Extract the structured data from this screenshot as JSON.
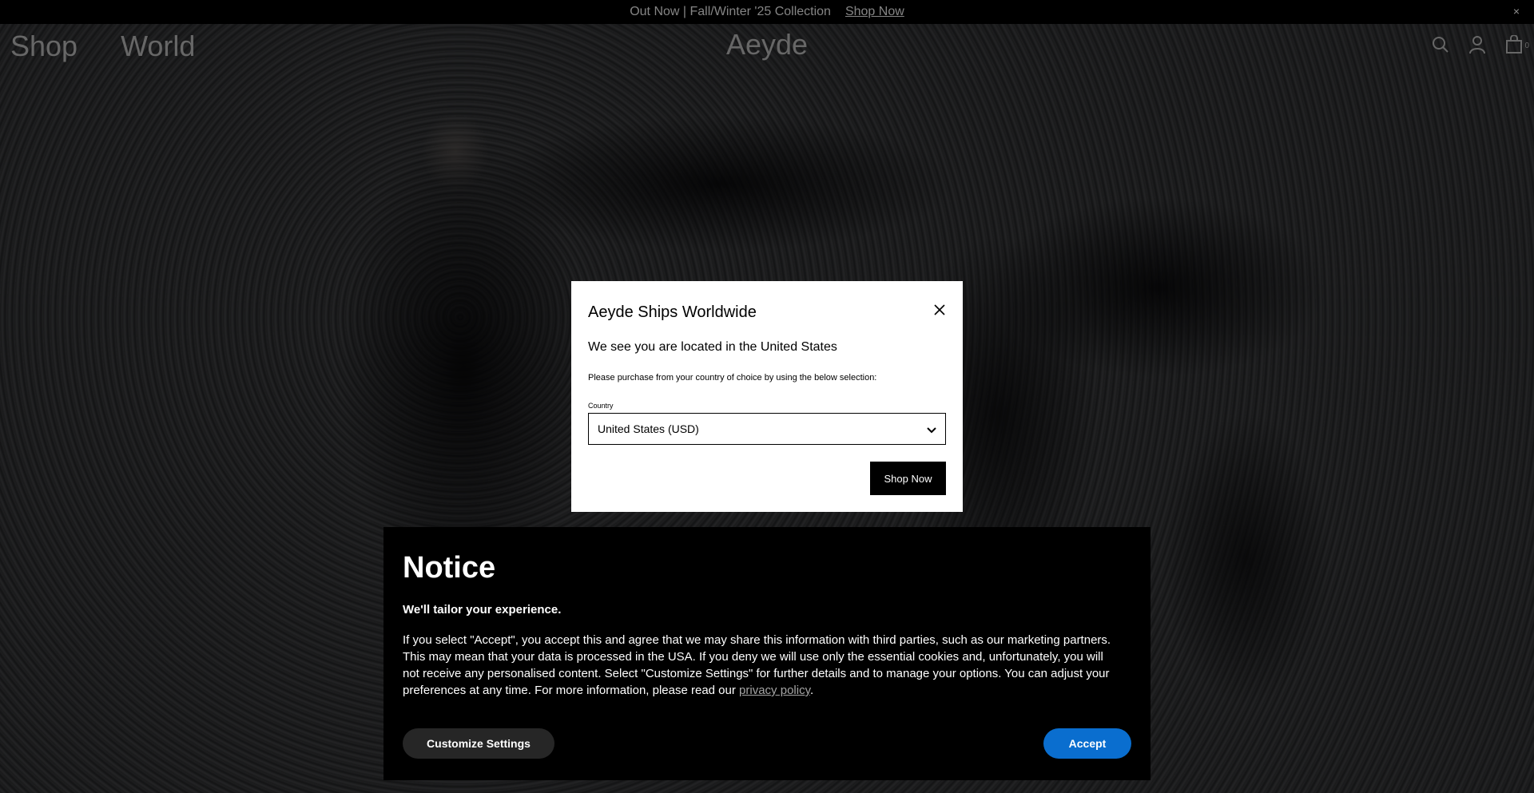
{
  "announcement": {
    "text": "Out Now | Fall/Winter '25 Collection",
    "link": "Shop Now",
    "close": "×"
  },
  "header": {
    "nav": [
      "Shop",
      "World"
    ],
    "logo": "Aeyde",
    "icons": [
      "search-icon",
      "account-icon",
      "bag-icon"
    ],
    "cart_count": "0"
  },
  "shipping_modal": {
    "title": "Aeyde Ships Worldwide",
    "location_text": "We see you are located in the United States",
    "instruction": "Please purchase from your country of choice by using the below selection:",
    "country_label": "Country",
    "country_value": "United States (USD)",
    "shop_button": "Shop Now"
  },
  "cookie_notice": {
    "title": "Notice",
    "subtitle": "We'll tailor your experience.",
    "body": "If you select \"Accept\", you accept this and agree that we may share this information with third parties, such as our marketing partners. This may mean that your data is processed in the USA. If you deny we will use only the essential cookies and, unfortunately, you will not receive any personalised content. Select \"Customize Settings\" for further details and to manage your options. You can adjust your preferences at any time. For more information, please read our ",
    "link": "privacy policy",
    "body_end": ".",
    "customize_button": "Customize Settings",
    "accept_button": "Accept"
  },
  "colors": {
    "accent": "#0a6ecf",
    "background": "#000000",
    "nav_text": "#8f8f8f"
  }
}
